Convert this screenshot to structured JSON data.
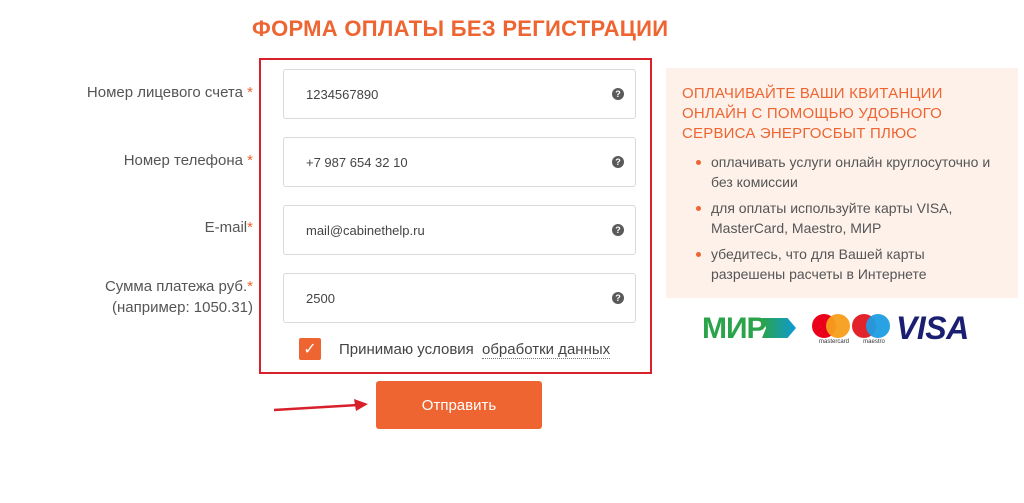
{
  "form": {
    "title": "ФОРМА ОПЛАТЫ БЕЗ РЕГИСТРАЦИИ",
    "fields": [
      {
        "label": "Номер лицевого счета",
        "required_mark": "*",
        "value": "1234567890"
      },
      {
        "label": "Номер телефона",
        "required_mark": "*",
        "value": "+7 987 654 32 10"
      },
      {
        "label": "E-mail",
        "required_mark": "*",
        "value": "mail@cabinethelp.ru"
      },
      {
        "label": "Сумма платежа руб.",
        "required_mark": "*",
        "label_line2": "(например: 1050.31)",
        "value": "2500"
      }
    ],
    "help_glyph": "?",
    "consent": {
      "checked": true,
      "text": "Принимаю условия",
      "link": "обработки данных"
    },
    "submit_label": "Отправить"
  },
  "info": {
    "heading": "ОПЛАЧИВАЙТЕ ВАШИ КВИТАНЦИИ ОНЛАЙН С ПОМОЩЬЮ УДОБНОГО СЕРВИСА ЭНЕРГОСБЫТ ПЛЮС",
    "items": [
      "оплачивать услуги онлайн круглосуточно и без комиссии",
      "для оплаты используйте карты VISA, MasterCard, Maestro, МИР",
      "убедитесь, что для Вашей карты разрешены расчеты в Интернете"
    ]
  },
  "payment_logos": {
    "mir": "МИР",
    "mastercard": "mastercard",
    "maestro": "maestro",
    "visa": "VISA"
  },
  "colors": {
    "accent": "#ee6532",
    "highlight_border": "#d8202a",
    "info_bg": "#fdf1ea"
  }
}
